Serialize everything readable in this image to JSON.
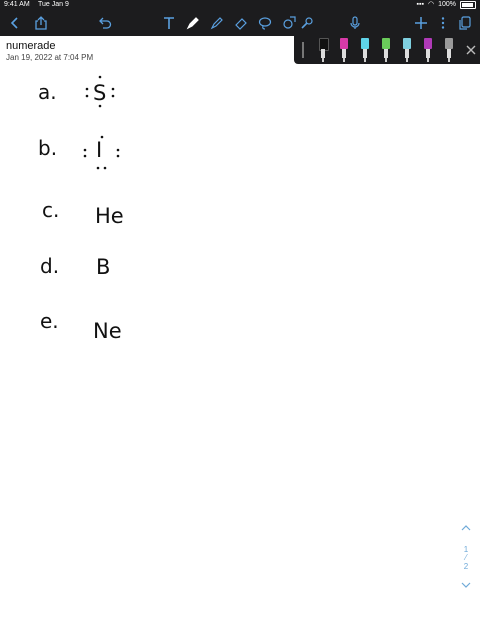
{
  "status": {
    "time": "9:41 AM",
    "date": "Tue Jan 9",
    "battery": "100%"
  },
  "document": {
    "title": "numerade",
    "date": "Jan 19, 2022 at 7:04 PM"
  },
  "toolbar": {
    "left_icons": [
      "back-icon",
      "share-icon",
      "undo-icon"
    ],
    "tools": [
      "text-tool-icon",
      "pen-tool-icon",
      "highlighter-tool-icon",
      "eraser-tool-icon",
      "lasso-tool-icon",
      "shapes-tool-icon",
      "image-tool-icon"
    ],
    "right_icons": [
      "microphone-icon",
      "add-icon",
      "more-icon",
      "pages-icon"
    ]
  },
  "pens": [
    {
      "name": "black-pen",
      "color": "#111111"
    },
    {
      "name": "magenta-pen",
      "color": "#d83aa8"
    },
    {
      "name": "cyan-pen",
      "color": "#5fd3e8"
    },
    {
      "name": "green-pen",
      "color": "#6acb5a"
    },
    {
      "name": "teal-pen",
      "color": "#7fd0e0"
    },
    {
      "name": "purple-pen",
      "color": "#b03ab8"
    },
    {
      "name": "gray-pen",
      "color": "#9a9a9a"
    }
  ],
  "handwriting": {
    "items": [
      {
        "label": "a.",
        "symbol": "S"
      },
      {
        "label": "b.",
        "symbol": "I"
      },
      {
        "label": "c.",
        "symbol": "He"
      },
      {
        "label": "d.",
        "symbol": "B"
      },
      {
        "label": "e.",
        "symbol": "Ne"
      }
    ]
  },
  "pager": {
    "current": "1",
    "total": "2"
  },
  "colors": {
    "chrome": "#1c1c1e",
    "accent": "#6fa9d8"
  }
}
